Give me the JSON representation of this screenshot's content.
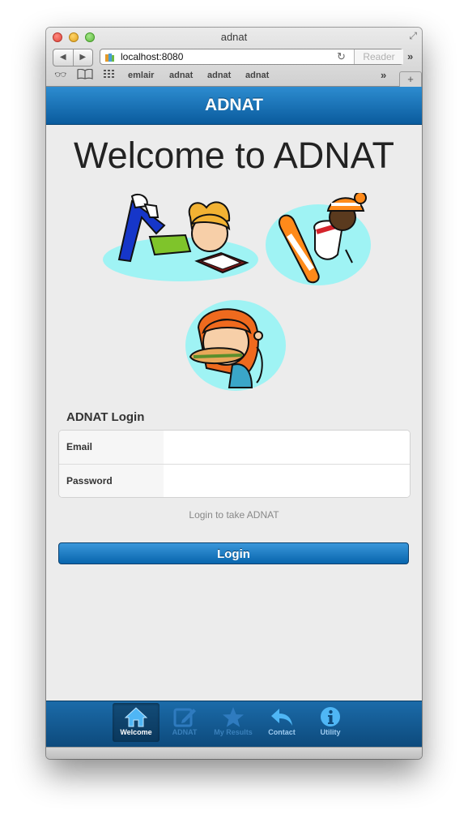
{
  "window": {
    "title": "adnat"
  },
  "toolbar": {
    "url": "localhost:8080",
    "reader_label": "Reader"
  },
  "bookmarks": [
    {
      "label": "emlair"
    },
    {
      "label": "adnat"
    },
    {
      "label": "adnat"
    },
    {
      "label": "adnat"
    }
  ],
  "header": {
    "title": "ADNAT"
  },
  "main": {
    "welcome": "Welcome to ADNAT",
    "illustrations": [
      "girl-reading-icon",
      "snowboarder-icon",
      "girl-eating-sandwich-icon"
    ]
  },
  "login": {
    "heading": "ADNAT Login",
    "email_label": "Email",
    "email_value": "",
    "password_label": "Password",
    "password_value": "",
    "hint": "Login to take ADNAT",
    "button_label": "Login"
  },
  "tabbar": {
    "tabs": [
      {
        "label": "Welcome",
        "icon": "home-icon",
        "active": true
      },
      {
        "label": "ADNAT",
        "icon": "edit-icon",
        "active": false
      },
      {
        "label": "My Results",
        "icon": "star-icon",
        "active": false
      },
      {
        "label": "Contact",
        "icon": "reply-icon",
        "active": false
      },
      {
        "label": "Utility",
        "icon": "info-icon",
        "active": false
      }
    ]
  },
  "colors": {
    "accent": "#0a5b9d",
    "button": "#1f7cc4",
    "background": "#ececec"
  }
}
